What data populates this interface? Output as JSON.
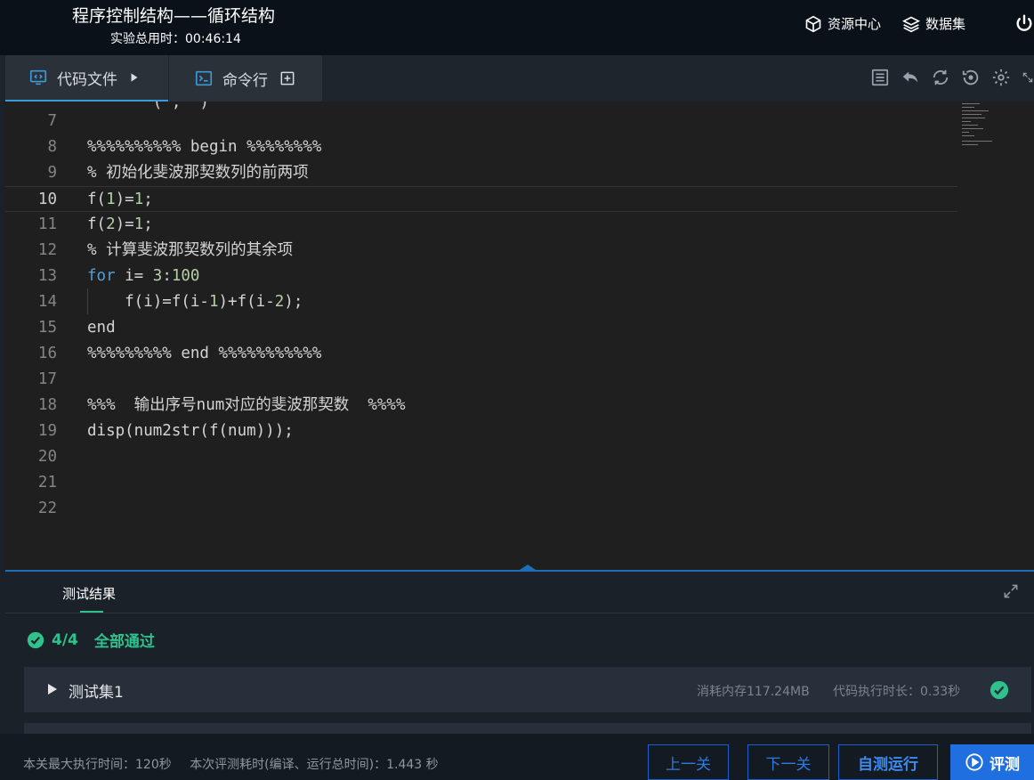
{
  "header": {
    "title": "程序控制结构——循环结构",
    "timer": "实验总用时：00:46:14",
    "actions": [
      {
        "label": "资源中心",
        "icon": "cube-icon"
      },
      {
        "label": "数据集",
        "icon": "layers-icon"
      }
    ],
    "power_icon": "power-icon"
  },
  "tabs": [
    {
      "label": "代码文件",
      "icon": "code-monitor-icon",
      "after_icon": "play-arrow-icon"
    },
    {
      "label": "命令行",
      "icon": "terminal-icon",
      "after_icon": "add-square-icon"
    }
  ],
  "toolbar_icons": [
    "list-icon",
    "undo-icon",
    "refresh-icon",
    "history-icon",
    "gear-icon",
    "expand-icon"
  ],
  "editor": {
    "current_line": "10",
    "lines": [
      {
        "n": "7",
        "text": ""
      },
      {
        "n": "8",
        "text": "%%%%%%%%%% begin %%%%%%%%"
      },
      {
        "n": "9",
        "text": "% 初始化斐波那契数列的前两项"
      },
      {
        "n": "10",
        "text": "f(1)=1;"
      },
      {
        "n": "11",
        "text": "f(2)=1;"
      },
      {
        "n": "12",
        "text": "% 计算斐波那契数列的其余项"
      },
      {
        "n": "13",
        "text": "for i= 3:100"
      },
      {
        "n": "14",
        "text": "    f(i)=f(i-1)+f(i-2);"
      },
      {
        "n": "15",
        "text": "end"
      },
      {
        "n": "16",
        "text": "%%%%%%%%% end %%%%%%%%%%%"
      },
      {
        "n": "17",
        "text": ""
      },
      {
        "n": "18",
        "text": "%%%  输出序号num对应的斐波那契数  %%%%"
      },
      {
        "n": "19",
        "text": "disp(num2str(f(num)));"
      },
      {
        "n": "20",
        "text": ""
      },
      {
        "n": "21",
        "text": ""
      },
      {
        "n": "22",
        "text": ""
      }
    ]
  },
  "results": {
    "tab_label": "测试结果",
    "score": "4/4",
    "status": "全部通过",
    "testset": {
      "name": "测试集1",
      "memory": "消耗内存117.24MB",
      "time": "代码执行时长：0.33秒"
    }
  },
  "footer": {
    "max_time": "本关最大执行时间：120秒",
    "eval_time": "本次评测耗时(编译、运行总时间)：1.443 秒",
    "prev": "上一关",
    "next": "下一关",
    "self_test": "自测运行",
    "evaluate": "评测"
  },
  "colors": {
    "accent": "#1f6fe0",
    "success": "#2fc28c",
    "keyword": "#569cd6",
    "number": "#b5cea8"
  }
}
